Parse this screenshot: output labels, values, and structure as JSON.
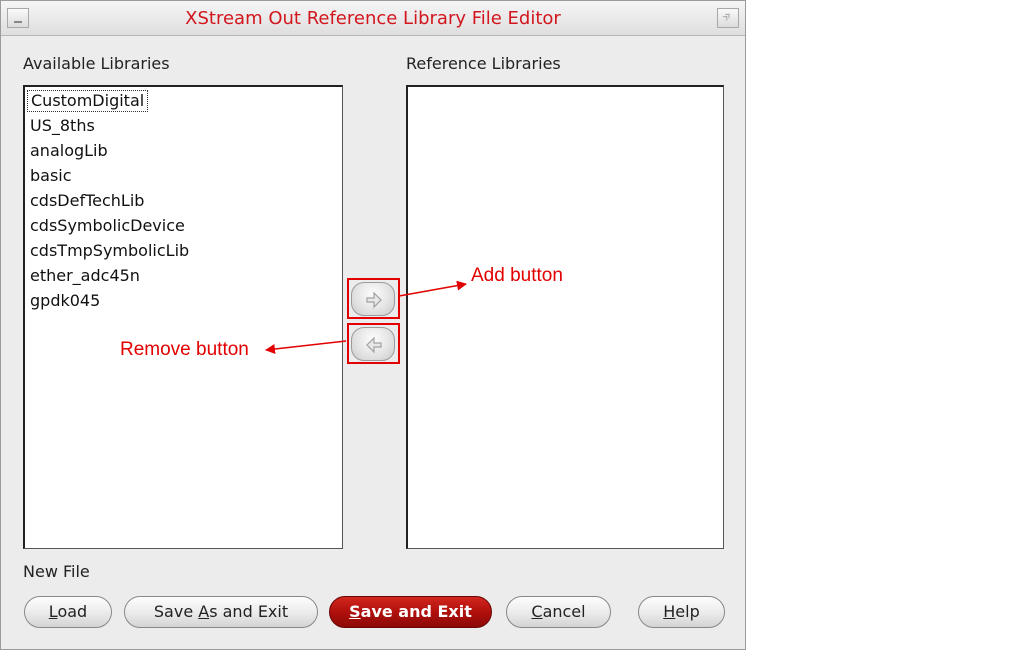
{
  "window": {
    "title": "XStream Out Reference Library File Editor"
  },
  "available": {
    "label": "Available Libraries",
    "items": [
      "CustomDigital",
      "US_8ths",
      "analogLib",
      "basic",
      "cdsDefTechLib",
      "cdsSymbolicDevice",
      "cdsTmpSymbolicLib",
      "ether_adc45n",
      "gpdk045"
    ],
    "selected": "CustomDigital"
  },
  "reference": {
    "label": "Reference Libraries",
    "items": []
  },
  "transfer": {
    "add_icon": "arrow-right-icon",
    "remove_icon": "arrow-left-icon"
  },
  "annotations": {
    "add": "Add button",
    "remove": "Remove button",
    "color": "#e20000"
  },
  "new_file_label": "New File",
  "buttons": {
    "load": {
      "mnemonic": "L",
      "rest": "oad"
    },
    "save_as": {
      "pre": "Save ",
      "mnemonic": "A",
      "rest": "s and Exit"
    },
    "save": {
      "mnemonic": "S",
      "rest": "ave and Exit"
    },
    "cancel": {
      "mnemonic": "C",
      "rest": "ancel"
    },
    "help": {
      "mnemonic": "H",
      "rest": "elp"
    }
  },
  "colors": {
    "title": "#d2161e",
    "primary_button": "#b0100c"
  }
}
